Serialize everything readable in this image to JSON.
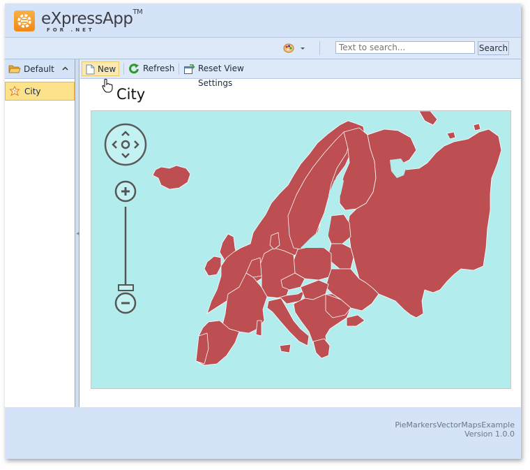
{
  "app": {
    "title": "eXpressApp",
    "trademark": "TM",
    "subtitle": "FOR .NET"
  },
  "topbar": {
    "theme_icon": "palette-icon",
    "search_placeholder": "Text to search...",
    "search_label": "Search"
  },
  "navigation": {
    "group_label": "Default",
    "group_icon": "folder-icon",
    "items": [
      {
        "label": "City",
        "icon": "city-icon",
        "selected": true
      }
    ]
  },
  "toolbar": {
    "new_label": "New",
    "refresh_label": "Refresh",
    "reset_label": "Reset View Settings"
  },
  "view": {
    "title": "City"
  },
  "map": {
    "region": "Europe",
    "background_color": "#b3ecec",
    "land_color": "#bd4e52",
    "border_color": "#ffffff",
    "controls": [
      "pan-control",
      "zoom-in",
      "zoom-slider",
      "zoom-out"
    ],
    "zoom_level": 0
  },
  "footer": {
    "app_name": "PieMarkersVectorMapsExample",
    "version": "Version 1.0.0"
  },
  "colors": {
    "header_bg": "#d4e3f7",
    "selected_item_bg": "#fde28c",
    "logo_orange": "#f39a24"
  }
}
